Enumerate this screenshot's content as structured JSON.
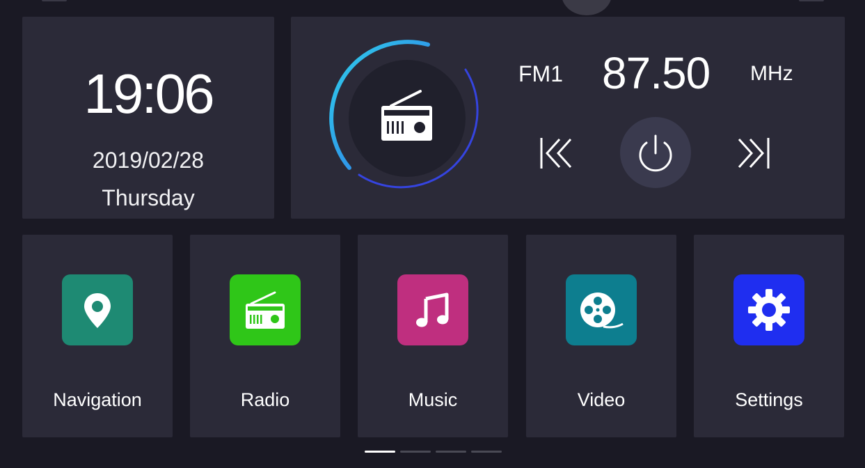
{
  "clock": {
    "time": "19:06",
    "date": "2019/02/28",
    "day": "Thursday"
  },
  "radio": {
    "band": "FM1",
    "frequency": "87.50",
    "unit": "MHz",
    "dial_icon": "radio-icon",
    "controls": {
      "prev_icon": "seek-back-icon",
      "power_icon": "power-icon",
      "next_icon": "seek-forward-icon"
    }
  },
  "apps": [
    {
      "label": "Navigation",
      "icon": "location-pin-icon",
      "color": "#1e8a73"
    },
    {
      "label": "Radio",
      "icon": "radio-icon",
      "color": "#2fc618"
    },
    {
      "label": "Music",
      "icon": "music-note-icon",
      "color": "#bf2f7f"
    },
    {
      "label": "Video",
      "icon": "film-reel-icon",
      "color": "#0d7e8f"
    },
    {
      "label": "Settings",
      "icon": "gear-icon",
      "color": "#1f2ef0"
    }
  ],
  "pager": {
    "pages": 4,
    "active_page": 1
  },
  "colors": {
    "background": "#1a1924",
    "card": "#2b2a38",
    "dial_arc_start": "#2ec6e6",
    "dial_arc_end": "#3b3ee0",
    "power_button": "#3a3a4e"
  }
}
